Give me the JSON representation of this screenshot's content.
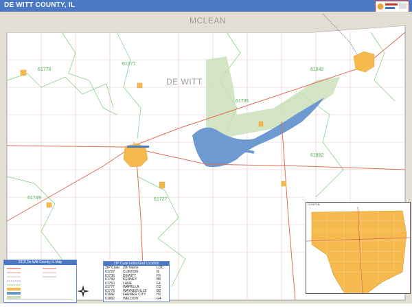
{
  "header": {
    "title": "DE WITT COUNTY, IL",
    "accent_color": "#4a78c2"
  },
  "map": {
    "counties": [
      {
        "label": "MCLEAN"
      },
      {
        "label": "DE WITT"
      }
    ],
    "zip_labels": [
      {
        "zip": "61778"
      },
      {
        "zip": "61777"
      },
      {
        "zip": "61842"
      },
      {
        "zip": "61735"
      },
      {
        "zip": "61882"
      },
      {
        "zip": "61749"
      },
      {
        "zip": "61727"
      }
    ],
    "colors": {
      "land": "#ffffff",
      "neighbor_fill": "#e3ded3",
      "urban": "#f5b94e",
      "water": "#6d9bd1",
      "parkland": "#c9dfb7",
      "zip_boundary": "#7ccc7c",
      "highway": "#e06c56",
      "road": "#d9a0a0",
      "county_line": "#a0a0a0"
    }
  },
  "legend": {
    "title": "2016 De Witt County, IL Map"
  },
  "zip_table": {
    "title": "ZIP Code Index/Grid Location",
    "columns": [
      "ZIP Code",
      "ZIP Name",
      "LOC"
    ],
    "rows": [
      {
        "zip": "61727",
        "name": "CLINTON",
        "loc": "I6"
      },
      {
        "zip": "61735",
        "name": "DEWITT",
        "loc": "F3"
      },
      {
        "zip": "61749",
        "name": "KENNEY",
        "loc": "B5"
      },
      {
        "zip": "61750",
        "name": "LANE",
        "loc": "F4"
      },
      {
        "zip": "61777",
        "name": "WAPELLA",
        "loc": "D2"
      },
      {
        "zip": "61778",
        "name": "WAYNESVILLE",
        "loc": "B2"
      },
      {
        "zip": "61842",
        "name": "FARMER CITY",
        "loc": "H2"
      },
      {
        "zip": "61882",
        "name": "WELDON",
        "loc": "G4"
      }
    ]
  },
  "inset": {
    "label": "CLINTON"
  }
}
